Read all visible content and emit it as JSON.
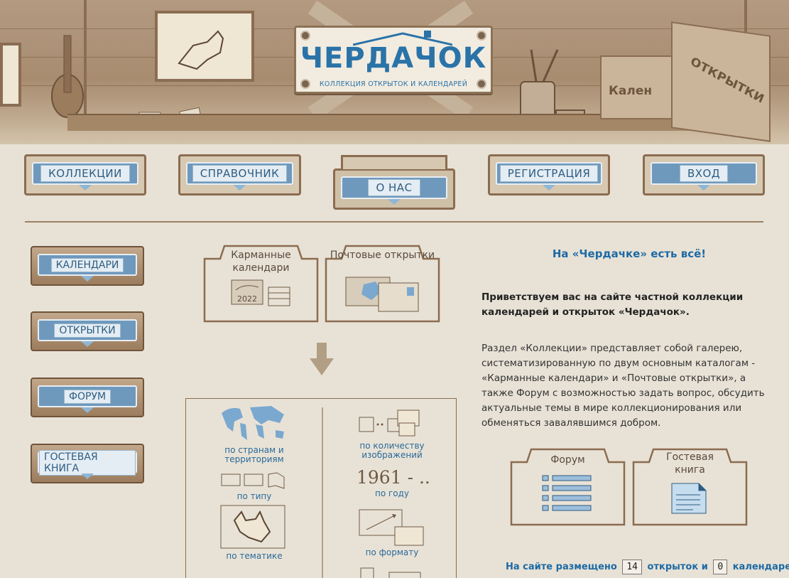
{
  "logo": {
    "title": "ЧЕРДАЧОК",
    "subtitle": "КОЛЛЕКЦИЯ ОТКРЫТОК И КАЛЕНДАРЕЙ",
    "box_left": "Кален",
    "box_right": "ОТКРЫТКИ"
  },
  "top_nav": [
    {
      "label": "КОЛЛЕКЦИИ"
    },
    {
      "label": "СПРАВОЧНИК"
    },
    {
      "label": "О НАС"
    },
    {
      "label": "РЕГИСТРАЦИЯ"
    },
    {
      "label": "ВХОД"
    }
  ],
  "side_nav": [
    {
      "label": "КАЛЕНДАРИ"
    },
    {
      "label": "ОТКРЫТКИ"
    },
    {
      "label": "ФОРУМ"
    },
    {
      "label": "ГОСТЕВАЯ КНИГА"
    }
  ],
  "folders": {
    "pocket_calendars": "Карманные календари",
    "pocket_year": "2022",
    "postcards": "Почтовые открытки",
    "forum": "Форум",
    "guestbook": "Гостевая книга"
  },
  "catalog": {
    "by_country": "по странам и территориям",
    "by_type": "по типу",
    "by_theme": "по тематике",
    "by_images": "по количеству изображений",
    "year_range": "1961 - ..",
    "by_year": "по году",
    "by_format": "по формату"
  },
  "content": {
    "headline": "На «Чердачке» есть всё!",
    "welcome": "Приветствуем вас на сайте частной коллекции календарей и открыток «Чердачок».",
    "description": "Раздел «Коллекции» представляет собой галерею, систематизированную по двум основным каталогам - «Карманные календари» и «Почтовые открытки», а также Форум с возможностью задать вопрос, обсудить актуальные темы в мире коллекционирования или обменяться завалявшимся добром."
  },
  "stats": {
    "prefix": "На сайте размещено",
    "postcards_count": "14",
    "middle": "открыток и",
    "calendars_count": "0",
    "suffix": "календарей"
  },
  "colors": {
    "accent_blue": "#2a73a8",
    "wood": "#8b6c50",
    "paper": "#e8e2d6"
  }
}
